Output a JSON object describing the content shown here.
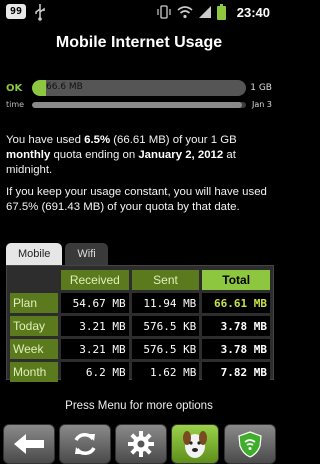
{
  "status_bar": {
    "notification_count": "99",
    "clock": "23:40",
    "icons": [
      "usb-icon",
      "vibrate-icon",
      "wifi-icon",
      "signal-icon",
      "battery-icon"
    ]
  },
  "title": "Mobile Internet Usage",
  "quota_bar": {
    "label": "OK",
    "fill_fraction": 0.065,
    "value_text": "66.6 MB",
    "limit_text": "1 GB",
    "color": "#8dc63f"
  },
  "time_bar": {
    "label": "time",
    "fill_fraction": 0.98,
    "end_text": "Jan 3"
  },
  "summary": {
    "p1_a": "You have used ",
    "p1_pct": "6.5%",
    "p1_b": " (66.61 MB) of your 1 GB ",
    "p1_period": "monthly",
    "p1_c": " quota ending on ",
    "p1_date": "January 2, 2012",
    "p1_d": " at midnight.",
    "p2": "If you keep your usage constant, you will have used 67.5% (691.43 MB) of your quota by that date."
  },
  "tabs": [
    {
      "label": "Mobile",
      "active": true
    },
    {
      "label": "Wifi",
      "active": false
    }
  ],
  "table": {
    "headers": [
      "Received",
      "Sent",
      "Total"
    ],
    "rows": [
      {
        "label": "Plan",
        "received": "54.67 MB",
        "sent": "11.94 MB",
        "total": "66.61 MB"
      },
      {
        "label": "Today",
        "received": "3.21 MB",
        "sent": "576.5 KB",
        "total": "3.78 MB"
      },
      {
        "label": "Week",
        "received": "3.21 MB",
        "sent": "576.5 KB",
        "total": "3.78 MB"
      },
      {
        "label": "Month",
        "received": "6.2 MB",
        "sent": "1.62 MB",
        "total": "7.82 MB"
      }
    ]
  },
  "footer": "Press Menu for more options",
  "toolbar": [
    "back-arrow-icon",
    "refresh-icon",
    "settings-gear-icon",
    "dog-app-icon",
    "shield-icon"
  ]
}
